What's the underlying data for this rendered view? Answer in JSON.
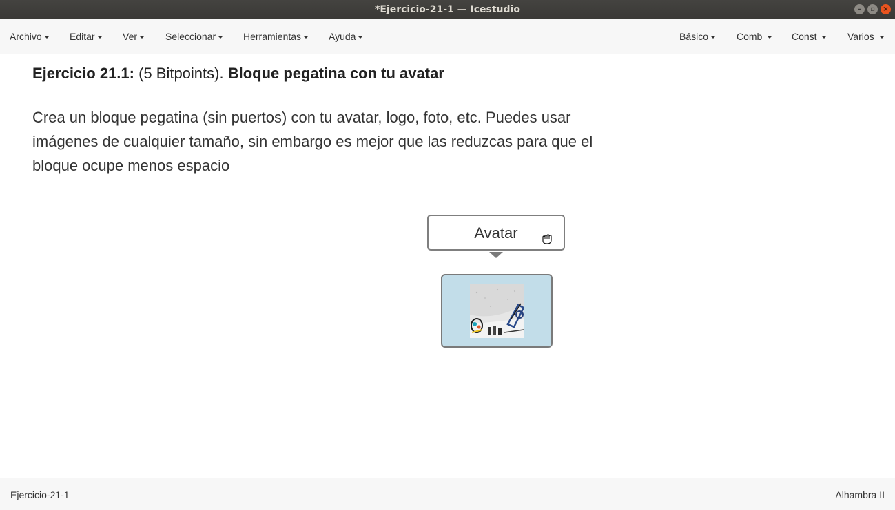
{
  "window": {
    "title": "*Ejercicio-21-1 — Icestudio",
    "controls": [
      "minimize-icon",
      "maximize-icon",
      "close-icon"
    ]
  },
  "menubar": {
    "left": [
      {
        "label": "Archivo"
      },
      {
        "label": "Editar"
      },
      {
        "label": "Ver"
      },
      {
        "label": "Seleccionar"
      },
      {
        "label": "Herramientas"
      },
      {
        "label": "Ayuda"
      }
    ],
    "right": [
      {
        "label": "Básico"
      },
      {
        "label": "Comb"
      },
      {
        "label": "Const"
      },
      {
        "label": "Varios"
      }
    ]
  },
  "content": {
    "heading_bold_1": "Ejercicio 21.1:",
    "heading_normal": " (5 Bitpoints). ",
    "heading_bold_2": "Bloque pegatina con tu avatar",
    "description": "Crea un bloque pegatina (sin puertos) con tu avatar, logo, foto, etc. Puedes usar imágenes de cualquier tamaño, sin embargo es mejor que las reduzcas para que el bloque ocupe menos espacio",
    "label_block": "Avatar",
    "sticker_image": "avatar-image",
    "cursor_icon": "hand-grab-icon"
  },
  "statusbar": {
    "project": "Ejercicio-21-1",
    "board": "Alhambra II"
  },
  "colors": {
    "titlebar": "#3c3b37",
    "menubar": "#f7f7f7",
    "sticker_bg": "#c2dde9",
    "close_button": "#e9541f"
  }
}
